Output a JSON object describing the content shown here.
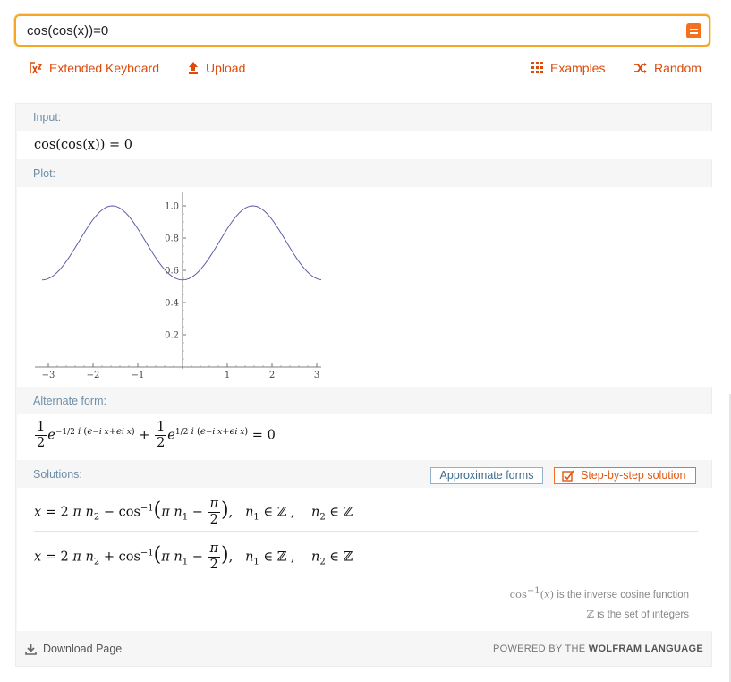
{
  "search": {
    "query": "cos(cos(x))=0"
  },
  "toolbar": {
    "extended_keyboard": "Extended Keyboard",
    "upload": "Upload",
    "examples": "Examples",
    "random": "Random"
  },
  "pods": {
    "input": {
      "title": "Input:",
      "expr": "cos(cos(x)) = 0"
    },
    "plot": {
      "title": "Plot:"
    },
    "alternate": {
      "title": "Alternate form:"
    },
    "solutions": {
      "title": "Solutions:",
      "approx_button": "Approximate forms",
      "step_button": "Step-by-step solution"
    }
  },
  "footnotes": {
    "inverse_cos": "is the inverse cosine function",
    "integers": "is the set of integers"
  },
  "footer": {
    "download": "Download Page",
    "powered_prefix": "POWERED BY THE",
    "powered_brand": "WOLFRAM LANGUAGE"
  },
  "colors": {
    "accent": "#f37021",
    "link": "#dd4a0a",
    "pod_title": "#6d8ea8",
    "curve": "#5b5ea6"
  },
  "chart_data": {
    "type": "line",
    "function": "cos(x)",
    "x": [
      -3.14,
      -2.62,
      -2.09,
      -1.57,
      -1.05,
      -0.52,
      0,
      0.52,
      1.05,
      1.57,
      2.09,
      2.62,
      3.14
    ],
    "y": [
      0.54,
      0.64,
      0.87,
      1.0,
      0.87,
      0.64,
      0.54,
      0.64,
      0.87,
      1.0,
      0.87,
      0.64,
      0.54
    ],
    "xlim": [
      -3.3,
      3.3
    ],
    "ylim": [
      0,
      1.05
    ],
    "xticks": [
      -3,
      -2,
      -1,
      1,
      2,
      3
    ],
    "xtick_labels": [
      "−3",
      "−2",
      "−1",
      "1",
      "2",
      "3"
    ],
    "yticks": [
      0.2,
      0.4,
      0.6,
      0.8,
      1.0
    ],
    "ytick_labels": [
      "0.2",
      "0.4",
      "0.6",
      "0.8",
      "1.0"
    ],
    "grid": false
  }
}
